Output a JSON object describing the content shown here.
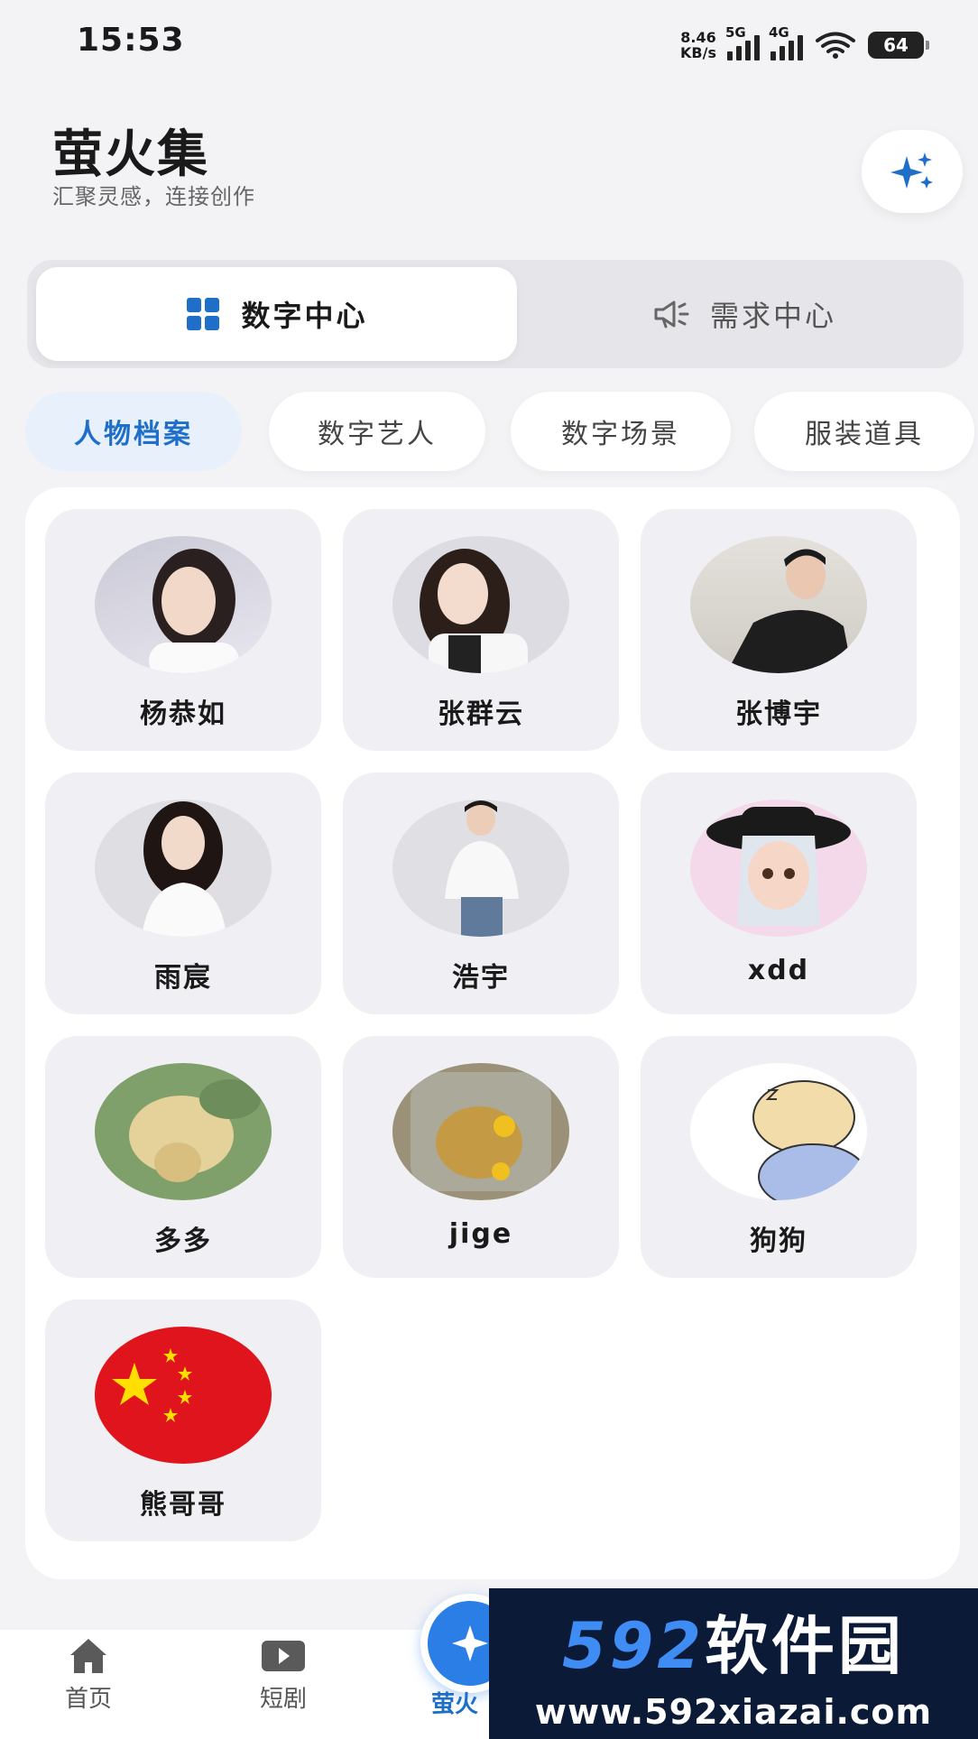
{
  "status_bar": {
    "time": "15:53",
    "net_speed_value": "8.46",
    "net_speed_unit": "KB/s",
    "signal1_label": "5G",
    "signal2_label": "4G",
    "battery": "64"
  },
  "header": {
    "title": "萤火集",
    "subtitle": "汇聚灵感，连接创作",
    "sparkle_icon": "sparkle-icon"
  },
  "segment_tabs": [
    {
      "label": "数字中心",
      "icon": "grid-icon",
      "active": true
    },
    {
      "label": "需求中心",
      "icon": "megaphone-icon",
      "active": false
    }
  ],
  "chips": [
    {
      "label": "人物档案",
      "active": true
    },
    {
      "label": "数字艺人",
      "active": false
    },
    {
      "label": "数字场景",
      "active": false
    },
    {
      "label": "服装道具",
      "active": false
    }
  ],
  "persons": [
    {
      "name": "杨恭如"
    },
    {
      "name": "张群云"
    },
    {
      "name": "张博宇"
    },
    {
      "name": "雨宸"
    },
    {
      "name": "浩宇"
    },
    {
      "name": "xdd"
    },
    {
      "name": "多多"
    },
    {
      "name": "jige"
    },
    {
      "name": "狗狗"
    },
    {
      "name": "熊哥哥"
    }
  ],
  "bottom_nav": {
    "home": "首页",
    "drama": "短剧",
    "center": "萤火"
  },
  "watermark": {
    "logo_num": "592",
    "logo_text": "软件园",
    "url": "www.592xiazai.com"
  },
  "colors": {
    "accent": "#1f6fc9",
    "active_chip_bg": "#e8f1fb",
    "card_bg": "#f0f0f4"
  }
}
